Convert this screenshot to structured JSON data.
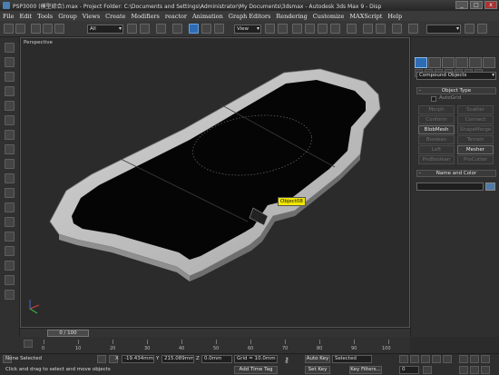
{
  "window": {
    "title": "PSP3000 (模型綜合).max   - Project Folder: C:\\Documents and Settings\\Administrator\\My Documents\\3dsmax   - Autodesk 3ds Max 9   - Disp",
    "btn_min": "_",
    "btn_max": "□",
    "btn_close": "x"
  },
  "menu": [
    "File",
    "Edit",
    "Tools",
    "Group",
    "Views",
    "Create",
    "Modifiers",
    "reactor",
    "Animation",
    "Graph Editors",
    "Rendering",
    "Customize",
    "MAXScript",
    "Help"
  ],
  "toolbar": {
    "selection_filter": "All",
    "ref_coord": "View"
  },
  "viewport": {
    "label": "Perspective",
    "tooltip": "Object08"
  },
  "command_panel": {
    "category": "Compound Objects",
    "object_type_title": "Object Type",
    "autogrid": "AutoGrid",
    "buttons": [
      "Morph",
      "Scatter",
      "Conform",
      "Connect",
      "BlobMesh",
      "ShapeMerge",
      "Boolean",
      "Terrain",
      "Loft",
      "Mesher",
      "ProBoolean",
      "ProCutter"
    ],
    "name_color_title": "Name and Color",
    "rollout_toggle": "-",
    "accent_color": "#4f7ba8"
  },
  "time": {
    "slider": "0 / 100",
    "ticks": [
      "0",
      "10",
      "20",
      "30",
      "40",
      "50",
      "60",
      "70",
      "80",
      "90",
      "100"
    ]
  },
  "status": {
    "selection": "None Selected",
    "prompt": "Click and drag to select and move objects",
    "x_label": "X",
    "x_value": "-19.434mm",
    "y_label": "Y",
    "y_value": "215.089mm",
    "z_label": "Z",
    "z_value": "0.0mm",
    "grid": "Grid = 10.0mm",
    "auto_key": "Auto Key",
    "selected": "Selected",
    "set_key": "Set Key",
    "key_filters": "Key Filters...",
    "add_time_tag": "Add Time Tag",
    "frame": "0"
  }
}
